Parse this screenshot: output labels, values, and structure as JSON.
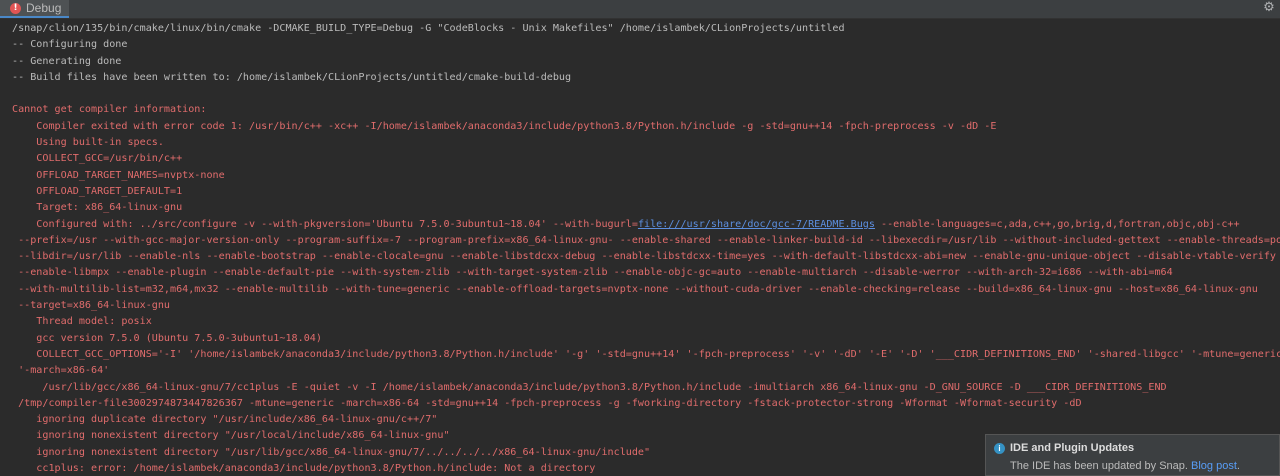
{
  "tab": {
    "label": "Debug"
  },
  "icons": {
    "tab": "error-icon",
    "settings": "gear-icon",
    "notification": "info-icon"
  },
  "colors": {
    "error_text": "#e06c6c",
    "info_text": "#bbbbbb",
    "link": "#5c8fe0"
  },
  "console": {
    "lines": [
      {
        "type": "info",
        "text": "/snap/clion/135/bin/cmake/linux/bin/cmake -DCMAKE_BUILD_TYPE=Debug -G \"CodeBlocks - Unix Makefiles\" /home/islambek/CLionProjects/untitled"
      },
      {
        "type": "info",
        "text": "-- Configuring done"
      },
      {
        "type": "info",
        "text": "-- Generating done"
      },
      {
        "type": "info",
        "text": "-- Build files have been written to: /home/islambek/CLionProjects/untitled/cmake-build-debug"
      },
      {
        "type": "info",
        "text": ""
      },
      {
        "type": "err",
        "text": "Cannot get compiler information:"
      },
      {
        "type": "err",
        "text": "    Compiler exited with error code 1: /usr/bin/c++ -xc++ -I/home/islambek/anaconda3/include/python3.8/Python.h/include -g -std=gnu++14 -fpch-preprocess -v -dD -E"
      },
      {
        "type": "err",
        "text": "    Using built-in specs."
      },
      {
        "type": "err",
        "text": "    COLLECT_GCC=/usr/bin/c++"
      },
      {
        "type": "err",
        "text": "    OFFLOAD_TARGET_NAMES=nvptx-none"
      },
      {
        "type": "err",
        "text": "    OFFLOAD_TARGET_DEFAULT=1"
      },
      {
        "type": "err",
        "text": "    Target: x86_64-linux-gnu"
      },
      {
        "type": "err",
        "text": "    Configured with: ../src/configure -v --with-pkgversion='Ubuntu 7.5.0-3ubuntu1~18.04' --with-bugurl=",
        "link": "file:///usr/share/doc/gcc-7/README.Bugs",
        "after": " --enable-languages=c,ada,c++,go,brig,d,fortran,objc,obj-c++"
      },
      {
        "type": "err",
        "text": " --prefix=/usr --with-gcc-major-version-only --program-suffix=-7 --program-prefix=x86_64-linux-gnu- --enable-shared --enable-linker-build-id --libexecdir=/usr/lib --without-included-gettext --enable-threads=posix"
      },
      {
        "type": "err",
        "text": " --libdir=/usr/lib --enable-nls --enable-bootstrap --enable-clocale=gnu --enable-libstdcxx-debug --enable-libstdcxx-time=yes --with-default-libstdcxx-abi=new --enable-gnu-unique-object --disable-vtable-verify"
      },
      {
        "type": "err",
        "text": " --enable-libmpx --enable-plugin --enable-default-pie --with-system-zlib --with-target-system-zlib --enable-objc-gc=auto --enable-multiarch --disable-werror --with-arch-32=i686 --with-abi=m64"
      },
      {
        "type": "err",
        "text": " --with-multilib-list=m32,m64,mx32 --enable-multilib --with-tune=generic --enable-offload-targets=nvptx-none --without-cuda-driver --enable-checking=release --build=x86_64-linux-gnu --host=x86_64-linux-gnu"
      },
      {
        "type": "err",
        "text": " --target=x86_64-linux-gnu"
      },
      {
        "type": "err",
        "text": "    Thread model: posix"
      },
      {
        "type": "err",
        "text": "    gcc version 7.5.0 (Ubuntu 7.5.0-3ubuntu1~18.04)"
      },
      {
        "type": "err",
        "text": "    COLLECT_GCC_OPTIONS='-I' '/home/islambek/anaconda3/include/python3.8/Python.h/include' '-g' '-std=gnu++14' '-fpch-preprocess' '-v' '-dD' '-E' '-D' '___CIDR_DEFINITIONS_END' '-shared-libgcc' '-mtune=generic'"
      },
      {
        "type": "err",
        "text": " '-march=x86-64'"
      },
      {
        "type": "err",
        "text": "     /usr/lib/gcc/x86_64-linux-gnu/7/cc1plus -E -quiet -v -I /home/islambek/anaconda3/include/python3.8/Python.h/include -imultiarch x86_64-linux-gnu -D_GNU_SOURCE -D ___CIDR_DEFINITIONS_END"
      },
      {
        "type": "err",
        "text": " /tmp/compiler-file3002974873447826367 -mtune=generic -march=x86-64 -std=gnu++14 -fpch-preprocess -g -fworking-directory -fstack-protector-strong -Wformat -Wformat-security -dD"
      },
      {
        "type": "err",
        "text": "    ignoring duplicate directory \"/usr/include/x86_64-linux-gnu/c++/7\""
      },
      {
        "type": "err",
        "text": "    ignoring nonexistent directory \"/usr/local/include/x86_64-linux-gnu\""
      },
      {
        "type": "err",
        "text": "    ignoring nonexistent directory \"/usr/lib/gcc/x86_64-linux-gnu/7/../../../../x86_64-linux-gnu/include\""
      },
      {
        "type": "err",
        "text": "    cc1plus: error: /home/islambek/anaconda3/include/python3.8/Python.h/include: Not a directory"
      }
    ]
  },
  "notification": {
    "title": "IDE and Plugin Updates",
    "body": "The IDE has been updated by Snap.",
    "link": "Blog post",
    "after": "."
  }
}
